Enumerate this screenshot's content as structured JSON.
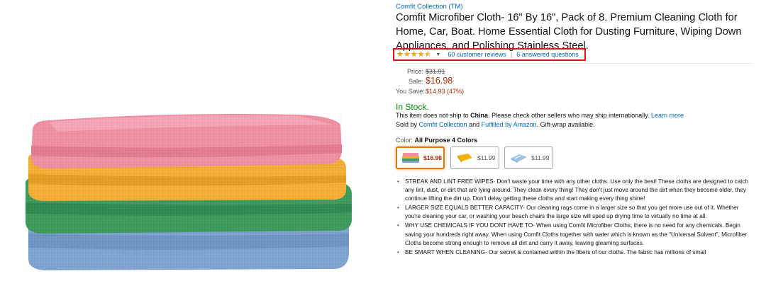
{
  "product": {
    "brand": "Comfit Collection (TM)",
    "title": "Comfit Microfiber Cloth- 16\" By 16\", Pack of 8. Premium Cleaning Cloth for Home, Car, Boat. Home Essential Cloth for Dusting Furniture, Wiping Down Appliances, and Polishing Stainless Steel."
  },
  "rating": {
    "stars": 4.5,
    "reviews_link": "60 customer reviews",
    "separator": "|",
    "questions_link": "6 answered questions"
  },
  "price": {
    "list_label": "Price:",
    "list_value": "$31.91",
    "sale_label": "Sale:",
    "sale_value": "$16.98",
    "save_label": "You Save:",
    "save_value": "$14.93 (47%)"
  },
  "availability": {
    "stock": "In Stock.",
    "ship_prefix": "This item does not ship to ",
    "ship_country": "China",
    "ship_suffix": ". Please check other sellers who may ship internationally. ",
    "learn_more": "Learn more",
    "sold_by_prefix": "Sold by ",
    "seller": "Comfit Collection",
    "and": " and ",
    "fulfilled": "Fulfilled by Amazon",
    "gift": ". Gift-wrap available."
  },
  "color": {
    "label": "Color:",
    "selected": "All Purpose 4 Colors",
    "options": [
      {
        "price": "$16.98",
        "selected": true
      },
      {
        "price": "$11.99",
        "selected": false
      },
      {
        "price": "$11.99",
        "selected": false
      }
    ]
  },
  "bullets": [
    "STREAK AND LINT FREE WIPES- Don't waste your time with any other cloths. Use only the best! These cloths are designed to catch any lint, dust, or dirt that are lying around. They clean every thing! They don't just move around the dirt when they become older, they continue lifting the dirt up. Don't delay getting these cloths and start making every thing shine!",
    "LARGER SIZE EQUALS BETTER CAPACITY- Our cleaning rags come in a larger size so that you get more use out of it. Whether you're cleaning your car, or washing your beach chairs the large size will sped up drying time to virtually no time at all.",
    "WHY USE CHEMICALS IF YOU DONT HAVE TO- When using Comfit Microfiber Cloths, there is no need for any chemicals. Begin saving your hundreds right away. When using Comfit Cloths together with water which is known as the \"Universal Solvent\", Microfiber Cloths become strong enough to remove all dirt and carry it away, leaving gleaming surfaces.",
    "BE SMART WHEN CLEANING- Our secret is contained within the fibers of our cloths. The fabric has millions of small"
  ],
  "colors": {
    "link": "#0066c0",
    "price_red": "#b12704",
    "in_stock": "#008a00",
    "highlight": "#e3131b",
    "star": "#f0a81c"
  }
}
